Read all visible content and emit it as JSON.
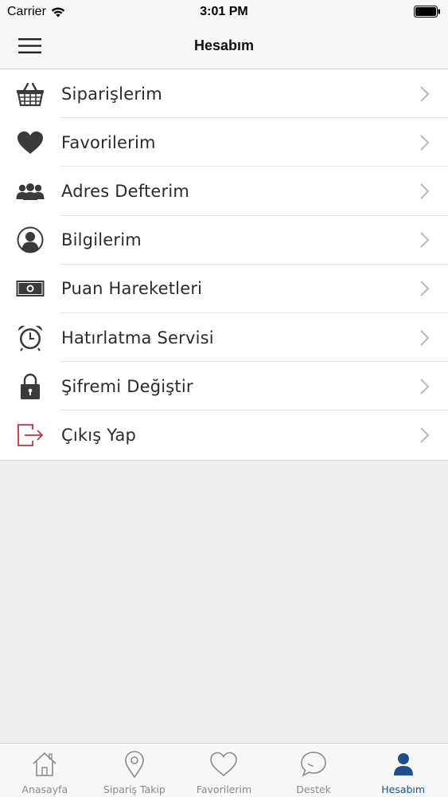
{
  "status_bar": {
    "carrier": "Carrier",
    "time": "3:01 PM"
  },
  "nav": {
    "title": "Hesabım"
  },
  "menu": {
    "items": [
      {
        "label": "Siparişlerim",
        "icon": "basket-icon"
      },
      {
        "label": "Favorilerim",
        "icon": "heart-icon"
      },
      {
        "label": "Adres Defterim",
        "icon": "people-icon"
      },
      {
        "label": "Bilgilerim",
        "icon": "user-circle-icon"
      },
      {
        "label": "Puan Hareketleri",
        "icon": "banknote-icon"
      },
      {
        "label": "Hatırlatma Servisi",
        "icon": "alarm-clock-icon"
      },
      {
        "label": "Şifremi Değiştir",
        "icon": "lock-icon"
      },
      {
        "label": "Çıkış Yap",
        "icon": "logout-icon"
      }
    ]
  },
  "tabs": [
    {
      "label": "Anasayfa",
      "icon": "home-icon",
      "active": false
    },
    {
      "label": "Sipariş Takip",
      "icon": "location-pin-icon",
      "active": false
    },
    {
      "label": "Favorilerim",
      "icon": "heart-outline-icon",
      "active": false
    },
    {
      "label": "Destek",
      "icon": "chat-bubble-icon",
      "active": false
    },
    {
      "label": "Hesabım",
      "icon": "person-icon",
      "active": true
    }
  ],
  "colors": {
    "active_tab": "#1f4f8c",
    "inactive_tab": "#8a8a8a",
    "logout_accent": "#c8323a",
    "icon_dark": "#3a3a3a"
  }
}
